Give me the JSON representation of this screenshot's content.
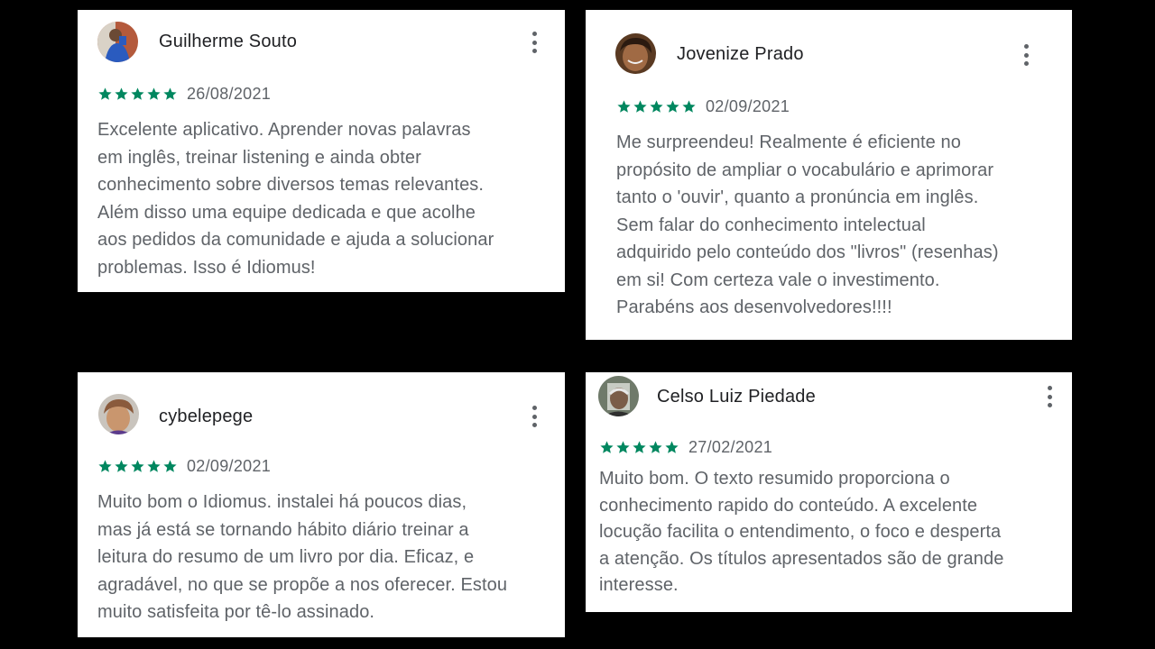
{
  "reviews": [
    {
      "author": "Guilherme Souto",
      "rating": 5,
      "date": "26/08/2021",
      "avatar_icon": "user-avatar",
      "text_lines": [
        "Excelente aplicativo. Aprender novas palavras",
        "em inglês, treinar listening e ainda obter",
        "conhecimento sobre diversos temas relevantes.",
        "Além disso uma equipe dedicada e que acolhe",
        "aos pedidos da comunidade e ajuda a solucionar",
        "problemas. Isso é Idiomus!"
      ]
    },
    {
      "author": "Jovenize Prado",
      "rating": 5,
      "date": "02/09/2021",
      "avatar_icon": "user-avatar",
      "text_lines": [
        "Me surpreendeu! Realmente é eficiente no",
        "propósito de ampliar o vocabulário e aprimorar",
        "tanto o 'ouvir', quanto a pronúncia em inglês.",
        "Sem falar do conhecimento intelectual",
        "adquirido pelo conteúdo dos \"livros\" (resenhas)",
        "em si! Com certeza vale o investimento.",
        "Parabéns aos desenvolvedores!!!!"
      ]
    },
    {
      "author": "cybelepege",
      "rating": 5,
      "date": "02/09/2021",
      "avatar_icon": "user-avatar",
      "text_lines": [
        "Muito bom o Idiomus. instalei há poucos dias,",
        "mas já está se tornando hábito diário treinar a",
        "leitura do resumo de um livro por dia. Eficaz, e",
        "agradável, no que se propõe a nos oferecer. Estou",
        "muito satisfeita por tê-lo assinado."
      ]
    },
    {
      "author": "Celso Luiz Piedade",
      "rating": 5,
      "date": "27/02/2021",
      "avatar_icon": "user-avatar",
      "text_lines": [
        "Muito bom. O texto resumido proporciona o",
        "conhecimento rapido do conteúdo. A excelente",
        "locução facilita o entendimento, o foco e desperta",
        "a atenção. Os títulos apresentados são de grande",
        "interesse."
      ]
    }
  ],
  "colors": {
    "background": "#000000",
    "card": "#ffffff",
    "star": "#01875f",
    "author_text": "#202124",
    "body_text": "#5f6368"
  },
  "icons": {
    "star": "star-icon",
    "menu": "more-vert-icon"
  }
}
